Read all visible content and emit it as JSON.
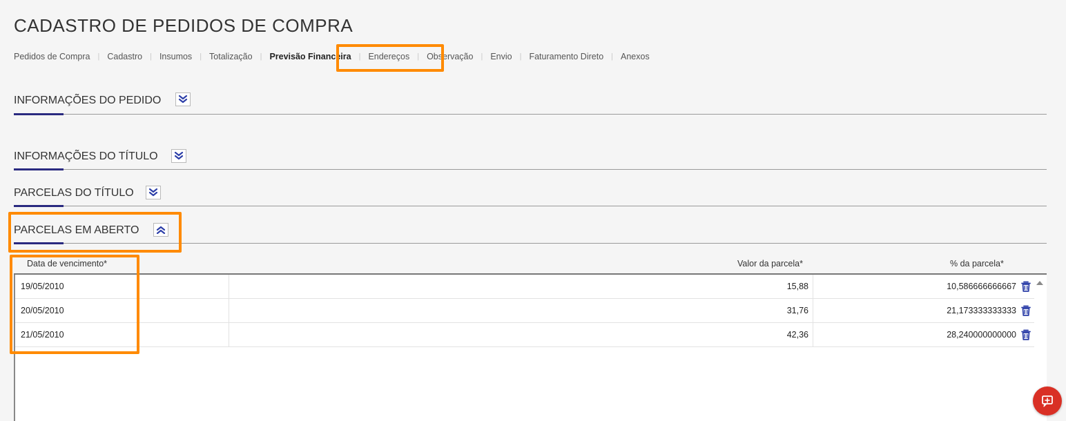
{
  "page": {
    "title": "CADASTRO DE PEDIDOS DE COMPRA"
  },
  "tabs": [
    {
      "label": "Pedidos de Compra"
    },
    {
      "label": "Cadastro"
    },
    {
      "label": "Insumos"
    },
    {
      "label": "Totalização"
    },
    {
      "label": "Previsão Financeira",
      "active": true
    },
    {
      "label": "Endereços"
    },
    {
      "label": "Observação"
    },
    {
      "label": "Envio"
    },
    {
      "label": "Faturamento Direto"
    },
    {
      "label": "Anexos"
    }
  ],
  "sections": {
    "info_pedido": {
      "title": "INFORMAÇÕES DO PEDIDO",
      "state": "collapsed"
    },
    "info_titulo": {
      "title": "INFORMAÇÕES DO TÍTULO",
      "state": "collapsed"
    },
    "parcelas_titulo": {
      "title": "PARCELAS DO TÍTULO",
      "state": "collapsed"
    },
    "parcelas_aberto": {
      "title": "PARCELAS EM ABERTO",
      "state": "expanded"
    }
  },
  "grid": {
    "columns": {
      "date": "Data de vencimento*",
      "value": "Valor da parcela*",
      "percent": "% da parcela*"
    },
    "rows": [
      {
        "date": "19/05/2010",
        "value": "15,88",
        "percent": "10,586666666667"
      },
      {
        "date": "20/05/2010",
        "value": "31,76",
        "percent": "21,173333333333"
      },
      {
        "date": "21/05/2010",
        "value": "42,36",
        "percent": "28,240000000000"
      }
    ]
  },
  "icons": {
    "expand": "double-chevron-down-icon",
    "collapse": "double-chevron-up-icon",
    "delete": "trash-icon",
    "scroll": "triangle-up-icon",
    "fab": "feedback-icon"
  },
  "colors": {
    "highlight": "#ff8a00",
    "accent": "#2a2a80",
    "toggle_icon": "#2c3ea8",
    "trash_icon": "#2c3ea8",
    "fab": "#d93025"
  }
}
